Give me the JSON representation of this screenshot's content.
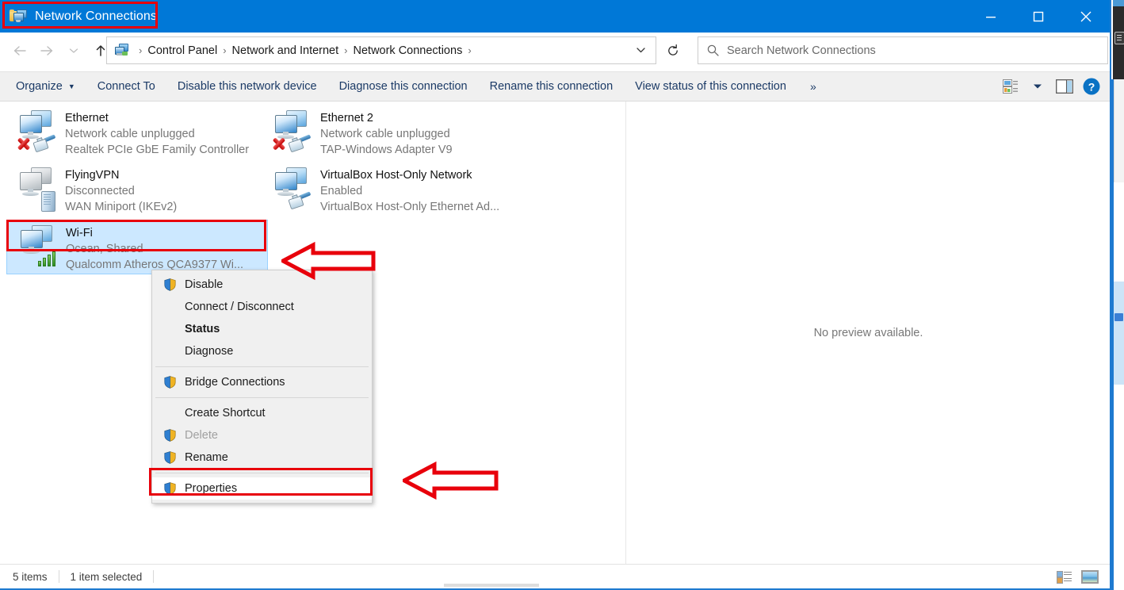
{
  "window": {
    "title": "Network Connections",
    "icon": "network-folder-icon",
    "controls": {
      "minimize": "minimize-icon",
      "maximize": "maximize-icon",
      "close": "close-icon"
    },
    "accent_color": "#0078d7",
    "annotation_color": "#e8000b"
  },
  "navigation": {
    "back": "back-arrow-icon",
    "forward": "forward-arrow-icon",
    "recent": "chevron-down-icon",
    "up": "up-arrow-icon",
    "breadcrumb": {
      "icon": "network-connections-icon",
      "items": [
        "Control Panel",
        "Network and Internet",
        "Network Connections"
      ],
      "separator": "›",
      "dropdown": "chevron-down-icon"
    },
    "refresh": "refresh-icon"
  },
  "search": {
    "icon": "search-icon",
    "placeholder": "Search Network Connections",
    "value": ""
  },
  "command_bar": {
    "items": [
      {
        "label": "Organize",
        "has_caret": true
      },
      {
        "label": "Connect To",
        "has_caret": false
      },
      {
        "label": "Disable this network device",
        "has_caret": false
      },
      {
        "label": "Diagnose this connection",
        "has_caret": false
      },
      {
        "label": "Rename this connection",
        "has_caret": false
      },
      {
        "label": "View status of this connection",
        "has_caret": false
      }
    ],
    "overflow": "»",
    "right_icons": [
      "change-view-icon",
      "view-dropdown-caret-icon",
      "preview-pane-icon",
      "help-icon"
    ]
  },
  "connections": [
    {
      "name": "Ethernet",
      "status": "Network cable unplugged",
      "adapter": "Realtek PCIe GbE Family Controller",
      "icon": "ethernet-adapter-icon",
      "badge": "red-x-icon",
      "selected": false
    },
    {
      "name": "Ethernet 2",
      "status": "Network cable unplugged",
      "adapter": "TAP-Windows Adapter V9",
      "icon": "ethernet-adapter-icon",
      "badge": "red-x-icon",
      "selected": false
    },
    {
      "name": "FlyingVPN",
      "status": "Disconnected",
      "adapter": "WAN Miniport (IKEv2)",
      "icon": "vpn-adapter-icon",
      "badge": "modem-icon",
      "selected": false
    },
    {
      "name": "VirtualBox Host-Only Network",
      "status": "Enabled",
      "adapter": "VirtualBox Host-Only Ethernet Ad...",
      "icon": "ethernet-adapter-icon",
      "badge": "rj45-icon",
      "selected": false
    },
    {
      "name": "Wi-Fi",
      "status": "Ocean, Shared",
      "adapter": "Qualcomm Atheros QCA9377 Wi...",
      "icon": "wifi-adapter-icon",
      "badge": "signal-bars-icon",
      "selected": true
    }
  ],
  "context_menu": {
    "items": [
      {
        "label": "Disable",
        "shield": true,
        "bold": false,
        "disabled": false,
        "separator_after": false
      },
      {
        "label": "Connect / Disconnect",
        "shield": false,
        "bold": false,
        "disabled": false,
        "separator_after": false
      },
      {
        "label": "Status",
        "shield": false,
        "bold": true,
        "disabled": false,
        "separator_after": false
      },
      {
        "label": "Diagnose",
        "shield": false,
        "bold": false,
        "disabled": false,
        "separator_after": true
      },
      {
        "label": "Bridge Connections",
        "shield": true,
        "bold": false,
        "disabled": false,
        "separator_after": true
      },
      {
        "label": "Create Shortcut",
        "shield": false,
        "bold": false,
        "disabled": false,
        "separator_after": false
      },
      {
        "label": "Delete",
        "shield": true,
        "bold": false,
        "disabled": true,
        "separator_after": false
      },
      {
        "label": "Rename",
        "shield": true,
        "bold": false,
        "disabled": false,
        "separator_after": true
      },
      {
        "label": "Properties",
        "shield": true,
        "bold": false,
        "disabled": false,
        "separator_after": false
      }
    ]
  },
  "preview_pane": {
    "message": "No preview available."
  },
  "status_bar": {
    "item_count": "5 items",
    "selection": "1 item selected",
    "view_icons": [
      "details-view-icon",
      "large-icons-view-icon"
    ]
  },
  "annotations": {
    "title_box": "highlights window title",
    "wifi_box": "highlights Wi-Fi connection",
    "properties_box": "highlights Properties menu item",
    "arrow_wifi": "left-pointing-arrow",
    "arrow_properties": "left-pointing-arrow"
  }
}
